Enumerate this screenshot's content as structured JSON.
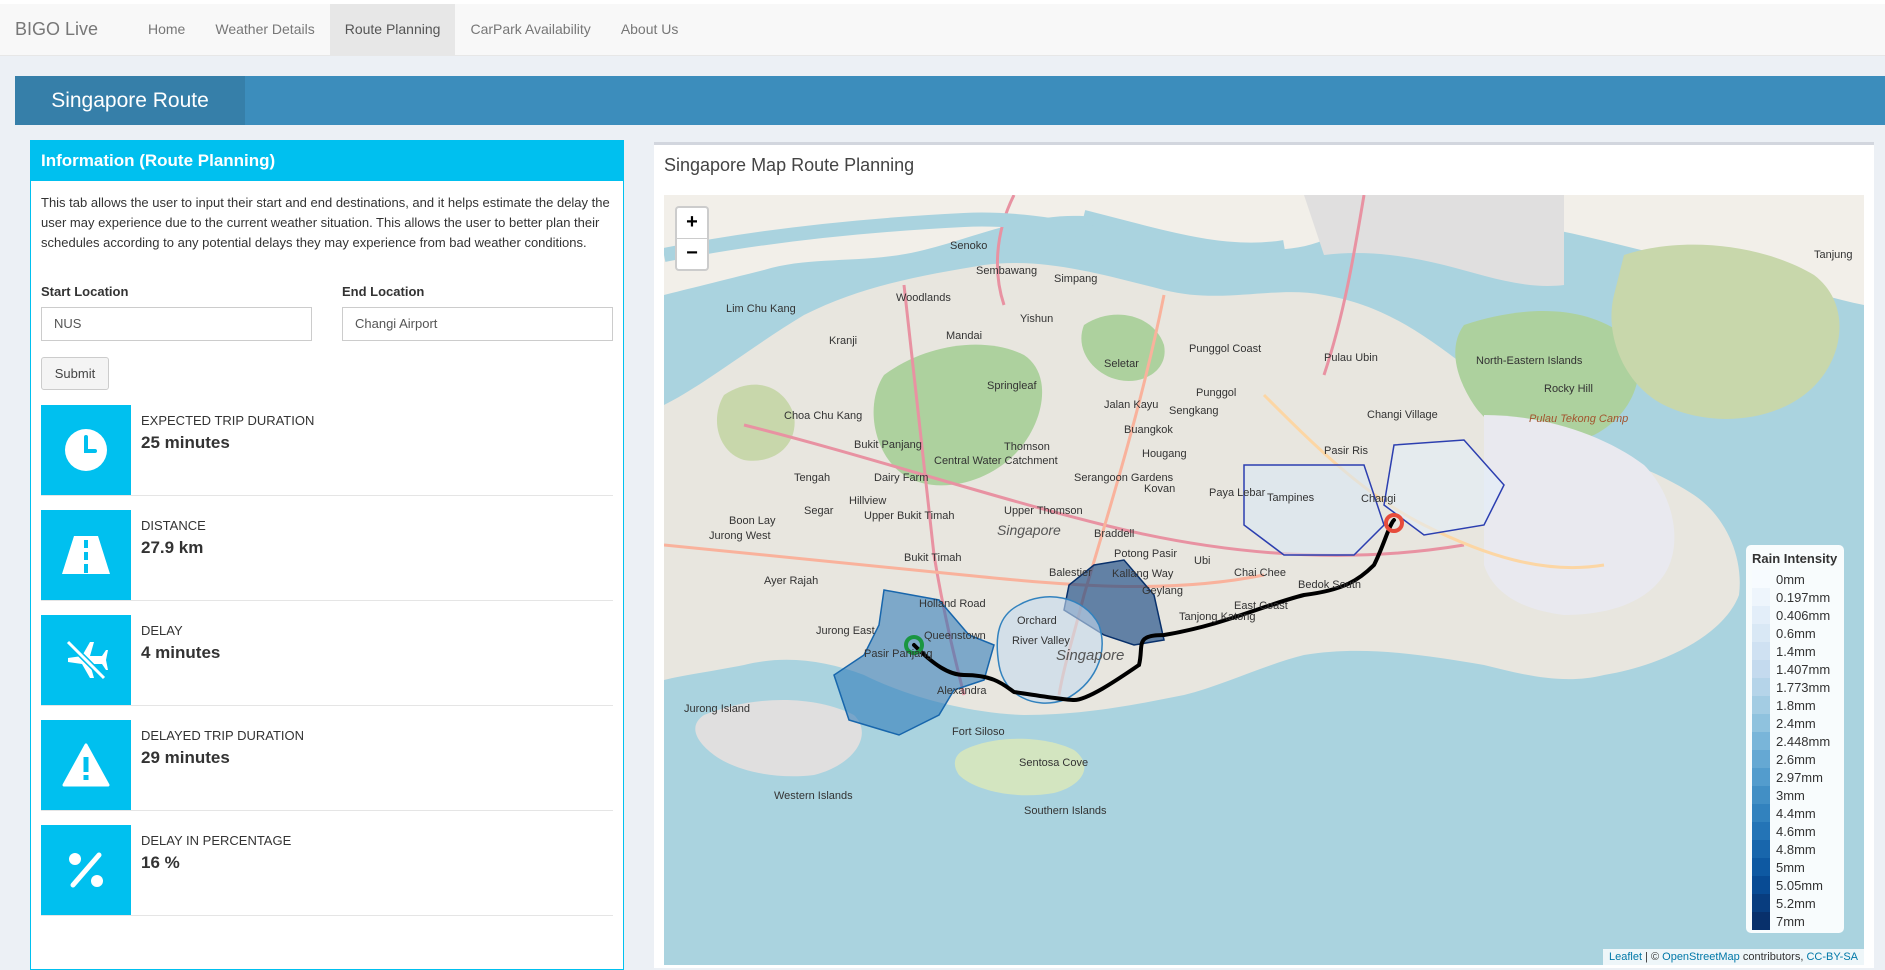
{
  "app": {
    "brand": "BIGO Live",
    "nav": [
      {
        "label": "Home",
        "active": false
      },
      {
        "label": "Weather Details",
        "active": false
      },
      {
        "label": "Route Planning",
        "active": true
      },
      {
        "label": "CarPark Availability",
        "active": false
      },
      {
        "label": "About Us",
        "active": false
      }
    ],
    "page_title": "Singapore Route"
  },
  "info": {
    "header": "Information (Route Planning)",
    "description": "This tab allows the user to input their start and end destinations, and it helps estimate the delay the user may experience due to the current weather situation. This allows the user to better plan their schedules according to any potential delays they may experience from bad weather conditions.",
    "start_label": "Start Location",
    "start_value": "NUS",
    "end_label": "End Location",
    "end_value": "Changi Airport",
    "submit_label": "Submit",
    "stats": [
      {
        "icon": "clock-icon",
        "label": "Expected Trip Duration",
        "value": "25 minutes"
      },
      {
        "icon": "road-icon",
        "label": "Distance",
        "value": "27.9 km"
      },
      {
        "icon": "plane-off-icon",
        "label": "Delay",
        "value": "4 minutes"
      },
      {
        "icon": "warning-icon",
        "label": "Delayed Trip Duration",
        "value": "29 minutes"
      },
      {
        "icon": "percent-icon",
        "label": "Delay in Percentage",
        "value": "16 %"
      }
    ]
  },
  "map": {
    "title": "Singapore Map Route Planning",
    "zoom_in": "+",
    "zoom_out": "−",
    "legend_title": "Rain Intensity",
    "legend": [
      {
        "label": "0mm",
        "color": "#f7fbff"
      },
      {
        "label": "0.197mm",
        "color": "#eef5fc"
      },
      {
        "label": "0.406mm",
        "color": "#e3eef9"
      },
      {
        "label": "0.6mm",
        "color": "#d9e8f5"
      },
      {
        "label": "1.4mm",
        "color": "#cfe1f2"
      },
      {
        "label": "1.407mm",
        "color": "#c4daee"
      },
      {
        "label": "1.773mm",
        "color": "#b5d4e9"
      },
      {
        "label": "1.8mm",
        "color": "#a3cce3"
      },
      {
        "label": "2.4mm",
        "color": "#8fc2de"
      },
      {
        "label": "2.448mm",
        "color": "#79b5d9"
      },
      {
        "label": "2.6mm",
        "color": "#65a8d3"
      },
      {
        "label": "2.97mm",
        "color": "#539ccd"
      },
      {
        "label": "3mm",
        "color": "#428fc5"
      },
      {
        "label": "4.4mm",
        "color": "#3282be"
      },
      {
        "label": "4.6mm",
        "color": "#2474b6"
      },
      {
        "label": "4.8mm",
        "color": "#1866ac"
      },
      {
        "label": "5mm",
        "color": "#0e59a2"
      },
      {
        "label": "5.05mm",
        "color": "#084b94"
      },
      {
        "label": "5.2mm",
        "color": "#083d7f"
      },
      {
        "label": "7mm",
        "color": "#08306b"
      }
    ],
    "attribution": {
      "leaflet": "Leaflet",
      "sep1": " | © ",
      "osm": "OpenStreetMap",
      "sep2": " contributors, ",
      "license": "CC-BY-SA"
    },
    "places": {
      "singapore_region": "Singapore",
      "singapore_city": "Singapore",
      "woodlands": "Woodlands",
      "yishun": "Yishun",
      "sembawang": "Sembawang",
      "seletar": "Seletar",
      "punggol": "Punggol",
      "sengkang": "Sengkang",
      "tampines": "Tampines",
      "changi": "Changi",
      "jurong_east": "Jurong East",
      "jurong_west": "Jurong West",
      "bukit_timah": "Bukit Timah",
      "queenstown": "Queenstown",
      "sentosa": "Sentosa Cove",
      "pasir_ris": "Pasir Ris",
      "bedok": "Bedok South",
      "marine_parade": "East Coast",
      "geylang": "Geylang",
      "toa_payoh": "Balestier",
      "serangoon": "Serangoon Gardens",
      "hougang": "Hougang",
      "ang_mo_kio": "Thomson",
      "kranji": "Kranji",
      "tengah": "Tengah",
      "jurong_island": "Jurong Island",
      "pulau_ubin": "Pulau Ubin",
      "pulau_tekong": "Pulau Tekong Camp",
      "western_islands": "Western Islands",
      "southern_islands": "Southern Islands",
      "mandai": "Mandai",
      "bukit_panjang": "Bukit Panjang",
      "choa_chu_kang": "Choa Chu Kang",
      "clementi": "Upper Bukit Timah",
      "paya_lebar": "Paya Lebar",
      "chai_chee": "Chai Chee",
      "kallang": "Kallang Way",
      "orchard": "Orchard",
      "pasir_panjang": "Pasir Panjang",
      "alexandra": "Alexandra",
      "fort_siloso": "Fort Siloso",
      "boon_lay": "Boon Lay",
      "senoko": "Senoko",
      "simpang": "Simpang",
      "lim_chu_kang": "Lim Chu Kang",
      "springleaf": "Springleaf",
      "punggol_coast": "Punggol Coast",
      "north_eastern": "North-Eastern Islands",
      "changi_village": "Changi Village",
      "buangkok": "Buangkok",
      "jalan_kayu": "Jalan Kayu",
      "central_water": "Central Water Catchment",
      "upper_thomson": "Upper Thomson",
      "hillview": "Hillview",
      "dairy_farm": "Dairy Farm",
      "segar": "Segar",
      "tanjong_katong": "Tanjong Katong",
      "river_valley": "River Valley",
      "holland": "Holland Road",
      "potong_pasir": "Potong Pasir",
      "kovan": "Kovan",
      "ubi": "Ubi",
      "braddell": "Braddell",
      "ayer_rajah": "Ayer Rajah",
      "pulau_tekong_label": "Rocky Hill",
      "tanjung": "Tanjung"
    }
  }
}
